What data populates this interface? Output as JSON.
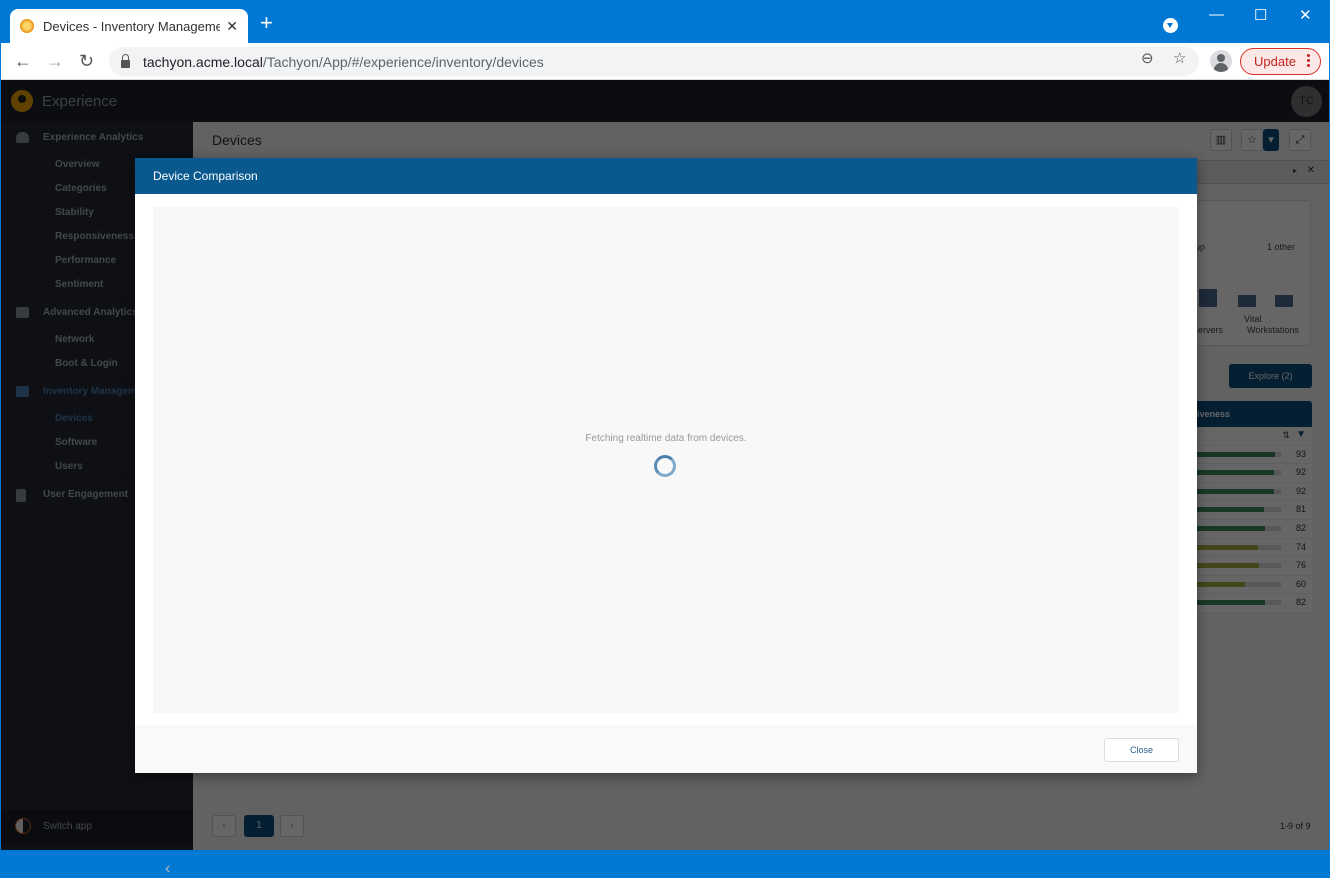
{
  "browser": {
    "tab_title": "Devices - Inventory Management",
    "url_host": "tachyon.acme.local",
    "url_path": "/Tachyon/App/#/experience/inventory/devices",
    "update_label": "Update",
    "icons": {
      "back": "←",
      "forward": "→",
      "reload": "↻",
      "zoom": "⊖",
      "star": "☆",
      "new_tab": "+",
      "close_tab": "✕",
      "minimize": "—",
      "maximize": "☐",
      "close_window": "✕"
    }
  },
  "app": {
    "name": "Experience",
    "user_initials": "TC"
  },
  "sidebar": {
    "groups": [
      {
        "label": "Experience Analytics",
        "icon": "dashboard-icon",
        "items": [
          "Overview",
          "Categories",
          "Stability",
          "Responsiveness",
          "Performance",
          "Sentiment"
        ]
      },
      {
        "label": "Advanced Analytics",
        "icon": "binoculars-icon",
        "items": [
          "Network",
          "Boot & Login"
        ]
      },
      {
        "label": "Inventory Management",
        "icon": "monitor-icon",
        "items": [
          "Devices",
          "Software",
          "Users"
        ],
        "active": true,
        "active_item": "Devices"
      },
      {
        "label": "User Engagement",
        "icon": "clipboard-icon",
        "items": []
      }
    ],
    "switch_app": "Switch app",
    "collapse_icon": "‹"
  },
  "page": {
    "title": "Devices",
    "card": {
      "group_label": "oup",
      "other_label": "1 other",
      "bar_labels": [
        "...\nServers",
        "Vital",
        "Workstations"
      ]
    },
    "explore_label": "Explore (2)",
    "table_header": "iveness",
    "responsiveness_values": [
      93,
      92,
      92,
      81,
      82,
      74,
      76,
      60,
      82
    ],
    "pagination": {
      "current": "1",
      "count_text": "1-9 of 9",
      "prev": "‹",
      "next": "›"
    }
  },
  "modal": {
    "title": "Device Comparison",
    "message": "Fetching realtime data from devices.",
    "close_label": "Close"
  },
  "colors": {
    "modal_header": "#09598f",
    "primary": "#0b4e7d",
    "bar_green": "#3d8a5a",
    "bar_yellow": "#a8b040"
  }
}
